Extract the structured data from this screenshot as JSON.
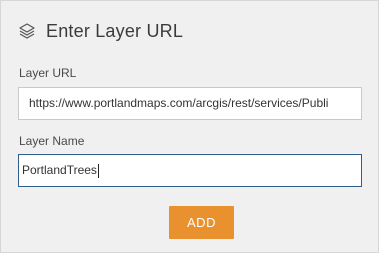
{
  "header": {
    "title": "Enter Layer URL",
    "icon": "layers-icon"
  },
  "form": {
    "url_label": "Layer URL",
    "url_value": "https://www.portlandmaps.com/arcgis/rest/services/Publi",
    "name_label": "Layer Name",
    "name_value": "PortlandTrees",
    "add_label": "ADD"
  },
  "colors": {
    "accent": "#e8912e",
    "focus_border": "#2f5d8c",
    "panel_bg": "#f0f0f0"
  }
}
